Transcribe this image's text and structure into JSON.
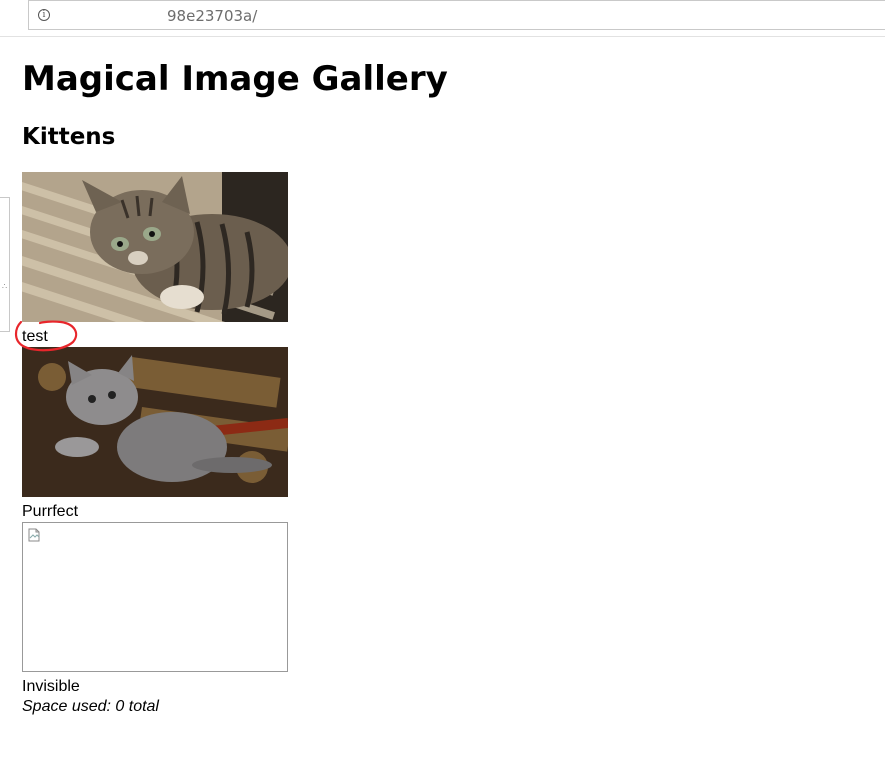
{
  "browser": {
    "url": "98e23703a/"
  },
  "page": {
    "title": "Magical Image Gallery",
    "section": "Kittens",
    "images": [
      {
        "caption": "test",
        "icon": "kitten-photo-tabby"
      },
      {
        "caption": "Purrfect",
        "icon": "kitten-photo-gray"
      },
      {
        "caption": "Invisible",
        "icon": "broken-image-icon"
      }
    ],
    "space_used": "Space used: 0 total"
  },
  "annotation": {
    "color": "#e8262b",
    "target": "test"
  }
}
